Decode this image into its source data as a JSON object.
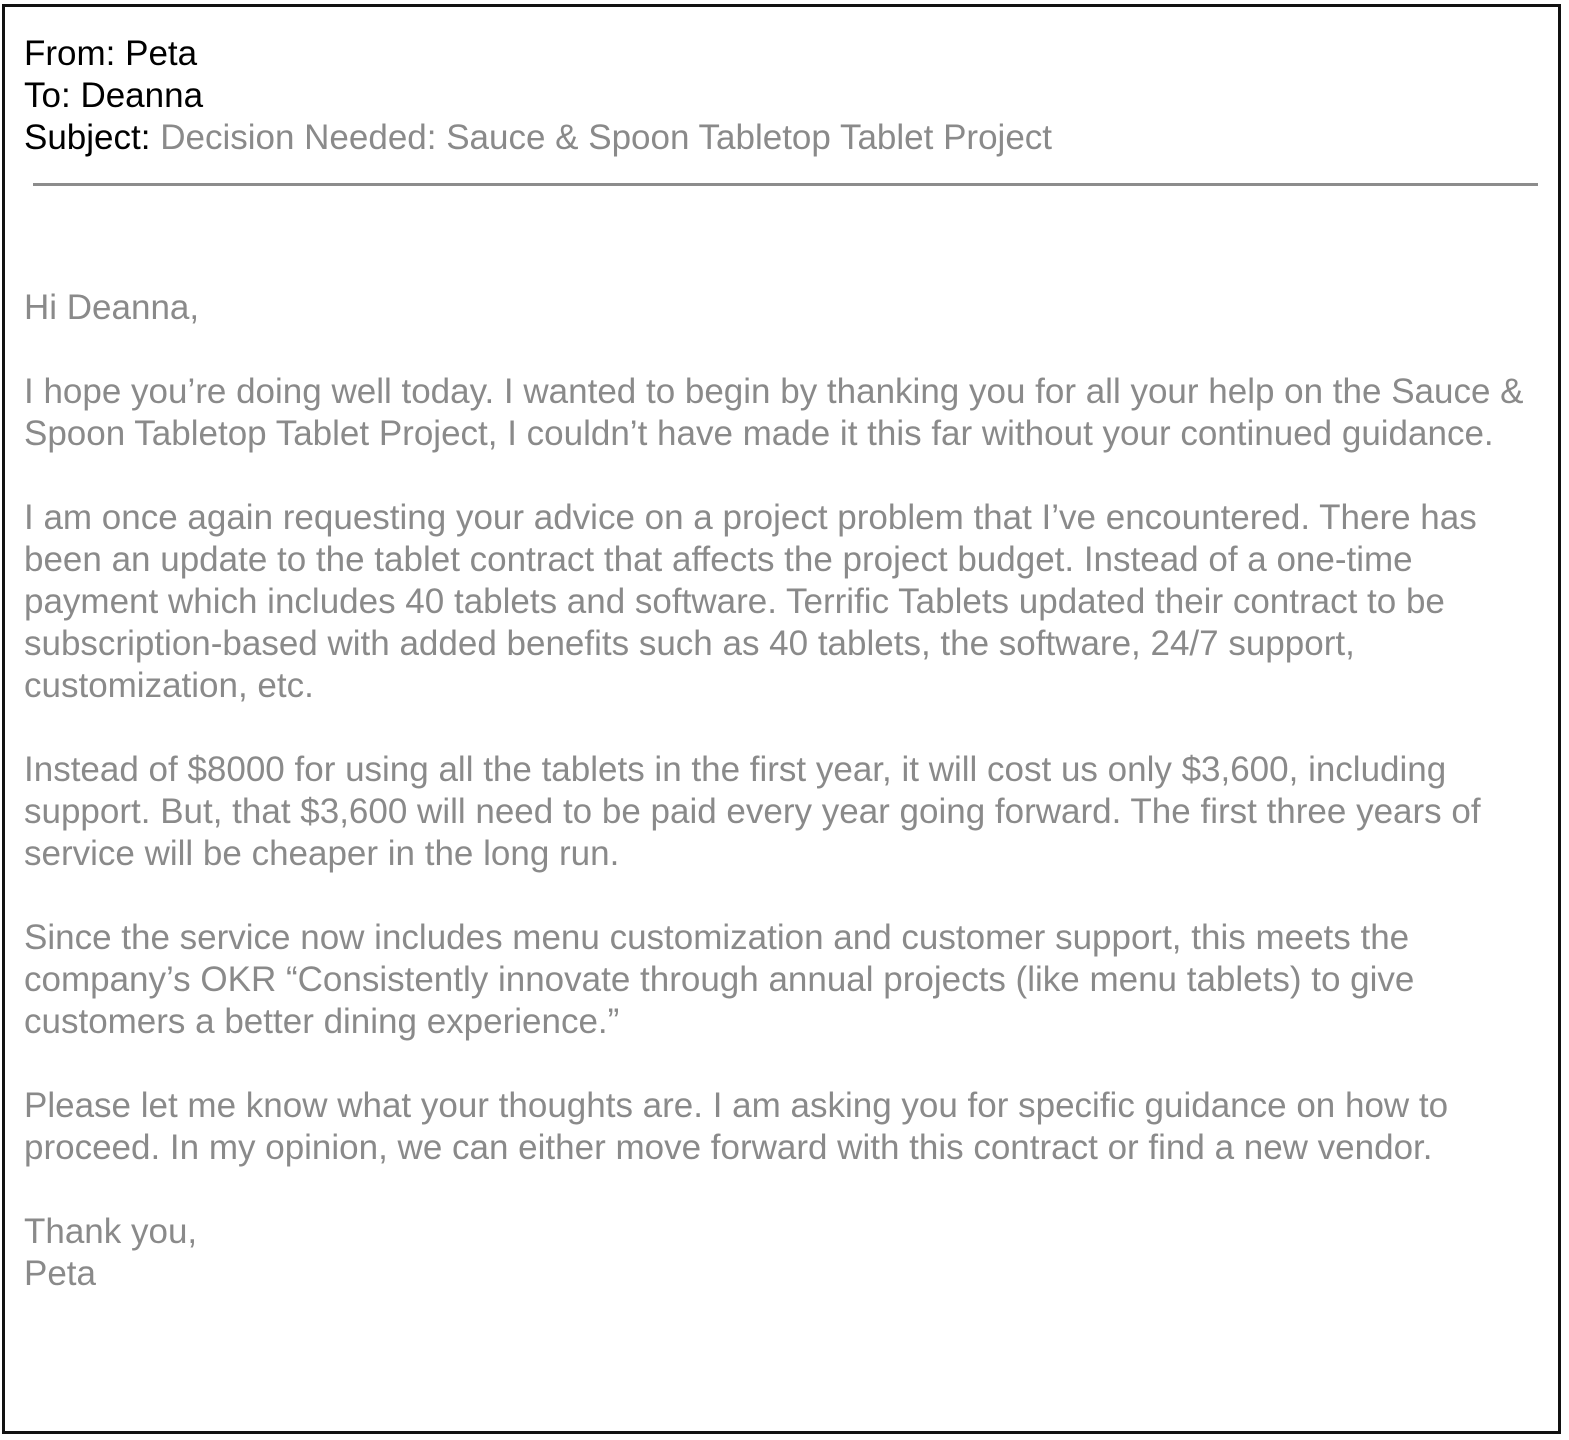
{
  "header": {
    "from_label": "From:",
    "from_value": "Peta",
    "to_label": "To:",
    "to_value": "Deanna",
    "subject_label": "Subject:",
    "subject_value": "Decision Needed: Sauce & Spoon Tabletop Tablet Project"
  },
  "body": {
    "greeting": "Hi Deanna,",
    "paragraphs": [
      "I hope you’re doing well today. I wanted to begin by thanking you for all your help on the Sauce & Spoon Tabletop Tablet Project, I couldn’t have made it this far without your continued guidance.",
      "I am once again requesting your advice on a project problem that I’ve encountered. There has been an update to the tablet contract that affects the project budget. Instead of a one-time payment which includes 40 tablets and software. Terrific Tablets updated their contract to be subscription-based with added benefits such as 40 tablets, the software, 24/7 support, customization, etc.",
      "Instead of $8000 for using all the tablets in the first year, it will cost us only $3,600, including support. But, that $3,600 will need to be paid every year going forward. The first three years of service will be cheaper in the long run.",
      "Since the service now includes menu customization and customer support, this meets the company’s OKR “Consistently innovate through annual projects (like menu tablets) to give customers a better dining experience.”",
      "Please let me know what your thoughts are. I am asking you for specific guidance on how to proceed. In my opinion, we can either move forward with this contract or find a new vendor."
    ],
    "closing": "Thank you,",
    "signature": "Peta"
  }
}
